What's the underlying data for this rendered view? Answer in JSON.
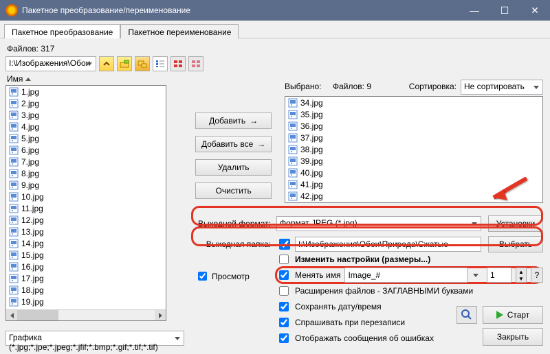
{
  "window": {
    "title": "Пакетное преобразование/переименование"
  },
  "tabs": [
    "Пакетное преобразование",
    "Пакетное переименование"
  ],
  "left": {
    "files_count": "Файлов: 317",
    "path": "I:\\Изображения\\Обои",
    "col_header": "Имя",
    "filter": "Графика (*.jpg;*.jpe;*.jpeg;*.jfif;*.bmp;*.gif;*.tif;*.tif)",
    "files": [
      "1.jpg",
      "2.jpg",
      "3.jpg",
      "4.jpg",
      "5.jpg",
      "6.jpg",
      "7.jpg",
      "8.jpg",
      "9.jpg",
      "10.jpg",
      "11.jpg",
      "12.jpg",
      "13.jpg",
      "14.jpg",
      "15.jpg",
      "16.jpg",
      "17.jpg",
      "18.jpg",
      "19.jpg"
    ]
  },
  "buttons": {
    "add": "Добавить",
    "add_all": "Добавить все",
    "remove": "Удалить",
    "clear": "Очистить",
    "start": "Старт",
    "close": "Закрыть"
  },
  "selected": {
    "label": "Выбрано:",
    "count": "Файлов: 9",
    "sort_label": "Сортировка:",
    "sort_value": "Не сортировать",
    "files": [
      "34.jpg",
      "35.jpg",
      "36.jpg",
      "37.jpg",
      "38.jpg",
      "39.jpg",
      "40.jpg",
      "41.jpg",
      "42.jpg"
    ]
  },
  "output": {
    "format_label": "Выходной формат:",
    "format_value": "Формат JPEG (*.jpg)",
    "options_btn": "Установки",
    "folder_label": "Выходная папка:",
    "folder_value": "I:\\Изображения\\Обои\\Природа\\Сжатые",
    "browse_btn": "Выбрать"
  },
  "options": {
    "preview": "Просмотр",
    "change_settings": "Изменить настройки (размеры...)",
    "rename": "Менять имя",
    "rename_pattern": "Image_#",
    "rename_start": "1",
    "upper_ext": "Расширения файлов - ЗАГЛАВНЫМИ буквами",
    "keep_date": "Сохранять дату/время",
    "ask_overwrite": "Спрашивать при перезаписи",
    "show_errors": "Отображать сообщения об ошибках"
  }
}
